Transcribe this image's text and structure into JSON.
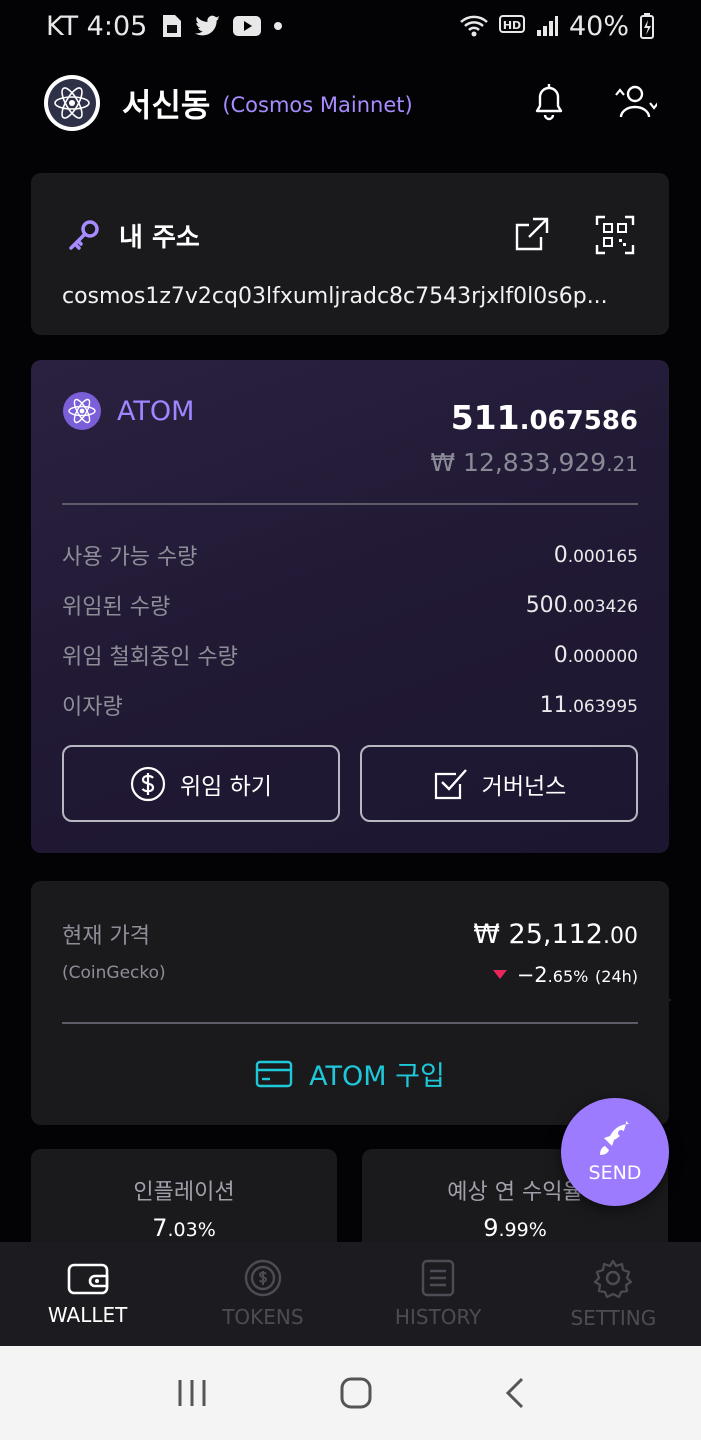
{
  "status_bar": {
    "carrier_time": "KT 4:05",
    "battery": "40%"
  },
  "header": {
    "wallet_name": "서신동",
    "chain_name": "(Cosmos Mainnet)"
  },
  "address_card": {
    "title": "내 주소",
    "address": "cosmos1z7v2cq03lfxumljradc8c7543rjxlf0l0s6p..."
  },
  "atom_card": {
    "token": "ATOM",
    "total_int": "511",
    "total_dec": ".067586",
    "krw_int": "₩ 12,833,929",
    "krw_dec": ".21",
    "rows": [
      {
        "label": "사용 가능 수량",
        "int": "0",
        "dec": ".000165"
      },
      {
        "label": "위임된 수량",
        "int": "500",
        "dec": ".003426"
      },
      {
        "label": "위임 철회중인 수량",
        "int": "0",
        "dec": ".000000"
      },
      {
        "label": "이자량",
        "int": "11",
        "dec": ".063995"
      }
    ],
    "delegate_label": "위임 하기",
    "governance_label": "거버넌스"
  },
  "price_card": {
    "label": "현재 가격",
    "source": "(CoinGecko)",
    "price_int": "₩ 25,112",
    "price_dec": ".00",
    "change_int": "−2",
    "change_dec": ".65%",
    "change_period": "(24h)",
    "buy_label": "ATOM 구입",
    "down_color": "#e8265a",
    "buy_color": "#1fc8d9"
  },
  "stats": {
    "inflation_label": "인플레이션",
    "inflation_int": "7",
    "inflation_dec": ".03%",
    "apr_label": "예상 연 수익율",
    "apr_int": "9",
    "apr_dec": ".99%"
  },
  "fab": {
    "label": "SEND"
  },
  "bottom_nav": {
    "items": [
      {
        "label": "WALLET",
        "icon": "wallet-icon"
      },
      {
        "label": "TOKENS",
        "icon": "tokens-icon"
      },
      {
        "label": "HISTORY",
        "icon": "history-icon"
      },
      {
        "label": "SETTING",
        "icon": "gear-icon"
      }
    ]
  },
  "colors": {
    "accent": "#9d7bff",
    "atom_text": "#9d86ff"
  }
}
